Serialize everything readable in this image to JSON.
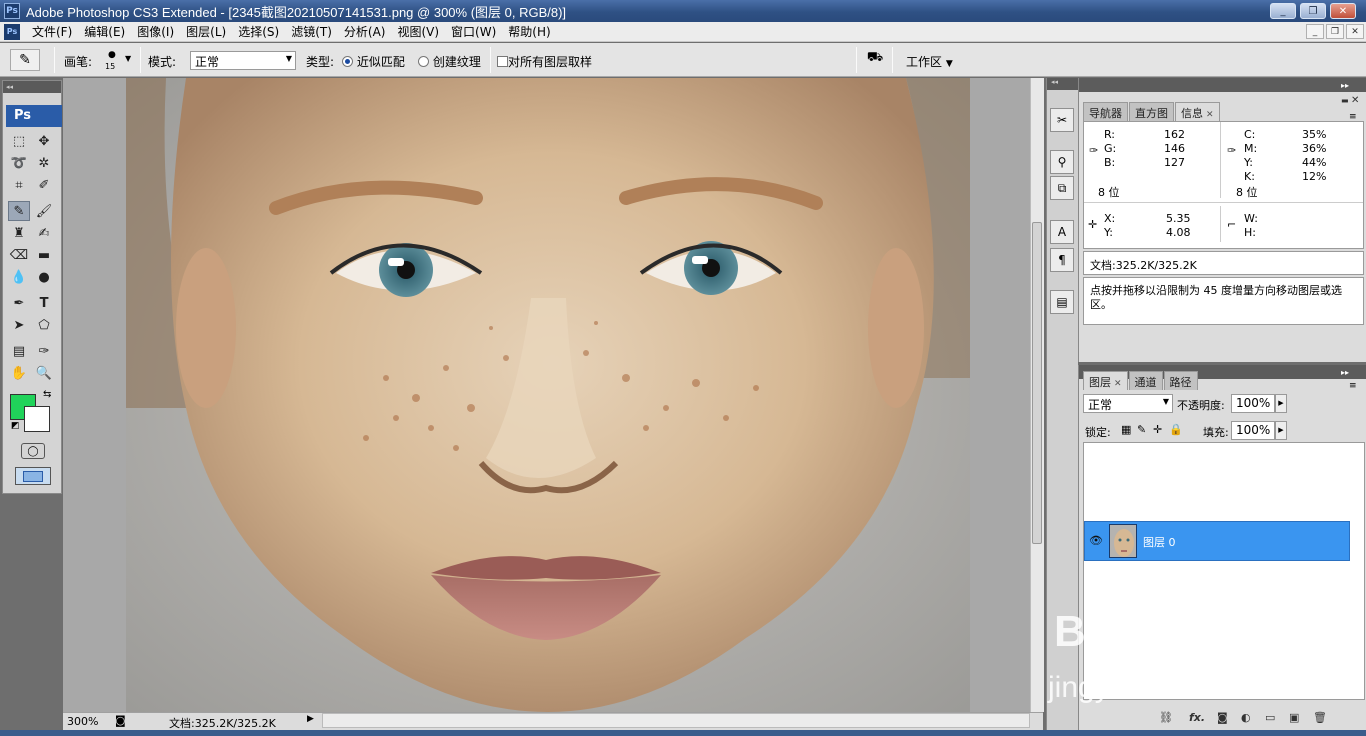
{
  "app": {
    "window_title": "Adobe Photoshop CS3 Extended - [2345截图20210507141531.png @ 300% (图层 0, RGB/8)]",
    "logo_text": "Ps",
    "window_controls": {
      "minimize": "_",
      "restore": "❐",
      "close": "✕"
    }
  },
  "menu": {
    "items": [
      "文件(F)",
      "编辑(E)",
      "图像(I)",
      "图层(L)",
      "选择(S)",
      "滤镜(T)",
      "分析(A)",
      "视图(V)",
      "窗口(W)",
      "帮助(H)"
    ]
  },
  "options": {
    "brush_label": "画笔:",
    "brush_size": "15",
    "mode_label": "模式:",
    "mode_value": "正常",
    "type_label": "类型:",
    "radio_proximity": "近似匹配",
    "radio_texture": "创建纹理",
    "sample_all_layers": "对所有图层取样",
    "workspace_label": "工作区"
  },
  "status": {
    "zoom": "300%",
    "doc_info": "文档:325.2K/325.2K"
  },
  "info_panel": {
    "tabs": [
      "导航器",
      "直方图",
      "信息"
    ],
    "active_tab": "信息",
    "rgb": {
      "R": "162",
      "G": "146",
      "B": "127"
    },
    "cmyk": {
      "C": "35%",
      "M": "36%",
      "Y": "44%",
      "K": "12%"
    },
    "bits_left": "8 位",
    "bits_right": "8 位",
    "coords": {
      "X": "5.35",
      "Y": "4.08"
    },
    "size_labels": {
      "W": "W:",
      "H": "H:"
    },
    "doc_info": "文档:325.2K/325.2K",
    "hint": "点按并拖移以沿限制为 45 度增量方向移动图层或选区。"
  },
  "layers_panel": {
    "tabs": [
      "图层",
      "通道",
      "路径"
    ],
    "active_tab": "图层",
    "blend_mode": "正常",
    "opacity_label": "不透明度:",
    "opacity_value": "100%",
    "lock_label": "锁定:",
    "fill_label": "填充:",
    "fill_value": "100%",
    "layer_name": "图层 0"
  },
  "watermark": {
    "brand": "Bai du 经验",
    "url": "jingyan.baidu.com"
  },
  "colors": {
    "foreground": "#20d35a",
    "background": "#ffffff",
    "selected_layer": "#3a95f0"
  }
}
